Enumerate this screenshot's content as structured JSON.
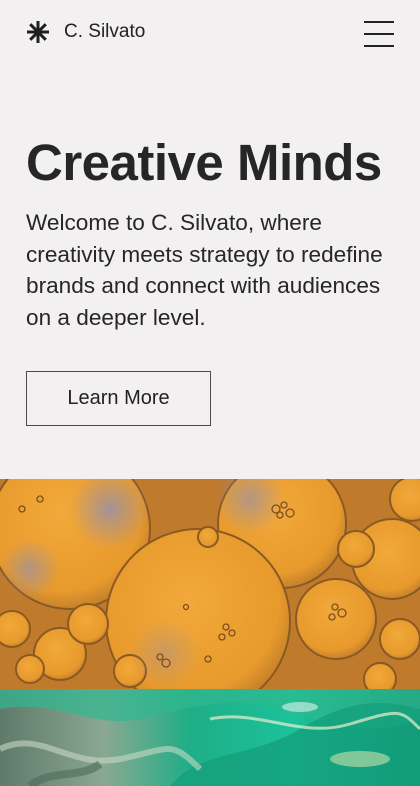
{
  "header": {
    "brand_name": "C. Silvato",
    "brand_icon": "asterisk-icon",
    "menu_icon": "hamburger-menu-icon"
  },
  "hero": {
    "title": "Creative Minds",
    "description": "Welcome to C. Silvato, where creativity meets strategy to redefine brands and connect with audiences on a deeper level.",
    "cta_label": "Learn More"
  },
  "colors": {
    "background": "#f2f0f0",
    "text": "#262626",
    "image_orange": "#e79a2e",
    "image_green": "#2a9a7a"
  }
}
